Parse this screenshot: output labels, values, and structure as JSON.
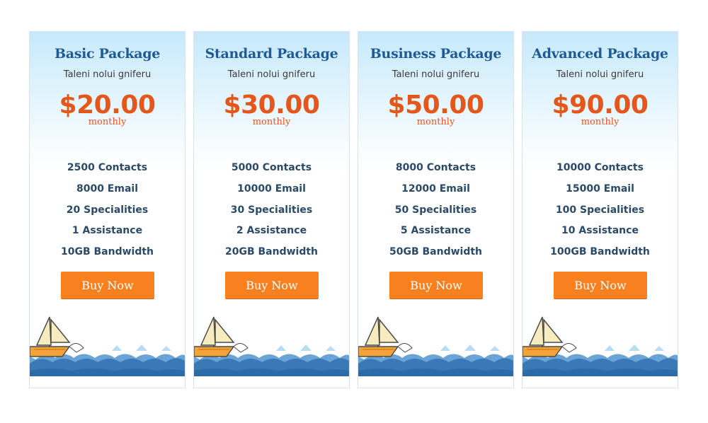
{
  "plans": [
    {
      "name": "Basic Package",
      "subtitle": "Taleni nolui gniferu",
      "price": "$20.00",
      "period": "monthly",
      "features": [
        "2500 Contacts",
        "8000 Email",
        "20 Specialities",
        "1 Assistance",
        "10GB Bandwidth"
      ],
      "button": "Buy Now"
    },
    {
      "name": "Standard Package",
      "subtitle": "Taleni nolui gniferu",
      "price": "$30.00",
      "period": "monthly",
      "features": [
        "5000 Contacts",
        "10000 Email",
        "30 Specialities",
        "2 Assistance",
        "20GB Bandwidth"
      ],
      "button": "Buy Now"
    },
    {
      "name": "Business Package",
      "subtitle": "Taleni nolui gniferu",
      "price": "$50.00",
      "period": "monthly",
      "features": [
        "8000 Contacts",
        "12000 Email",
        "50 Specialities",
        "5 Assistance",
        "50GB Bandwidth"
      ],
      "button": "Buy Now"
    },
    {
      "name": "Advanced Package",
      "subtitle": "Taleni nolui gniferu",
      "price": "$90.00",
      "period": "monthly",
      "features": [
        "10000 Contacts",
        "15000 Email",
        "100 Specialities",
        "10 Assistance",
        "100GB Bandwidth"
      ],
      "button": "Buy Now"
    }
  ],
  "colors": {
    "title": "#1d5a96",
    "price": "#e4571b",
    "feature_text": "#2a4a68",
    "button_bg": "#f9801e",
    "card_top": "#c6e9fb",
    "sea_dark": "#3b78b8",
    "sea_light": "#6aa3d6"
  },
  "icons": [
    "sailboat-illustration",
    "wave-illustration"
  ]
}
